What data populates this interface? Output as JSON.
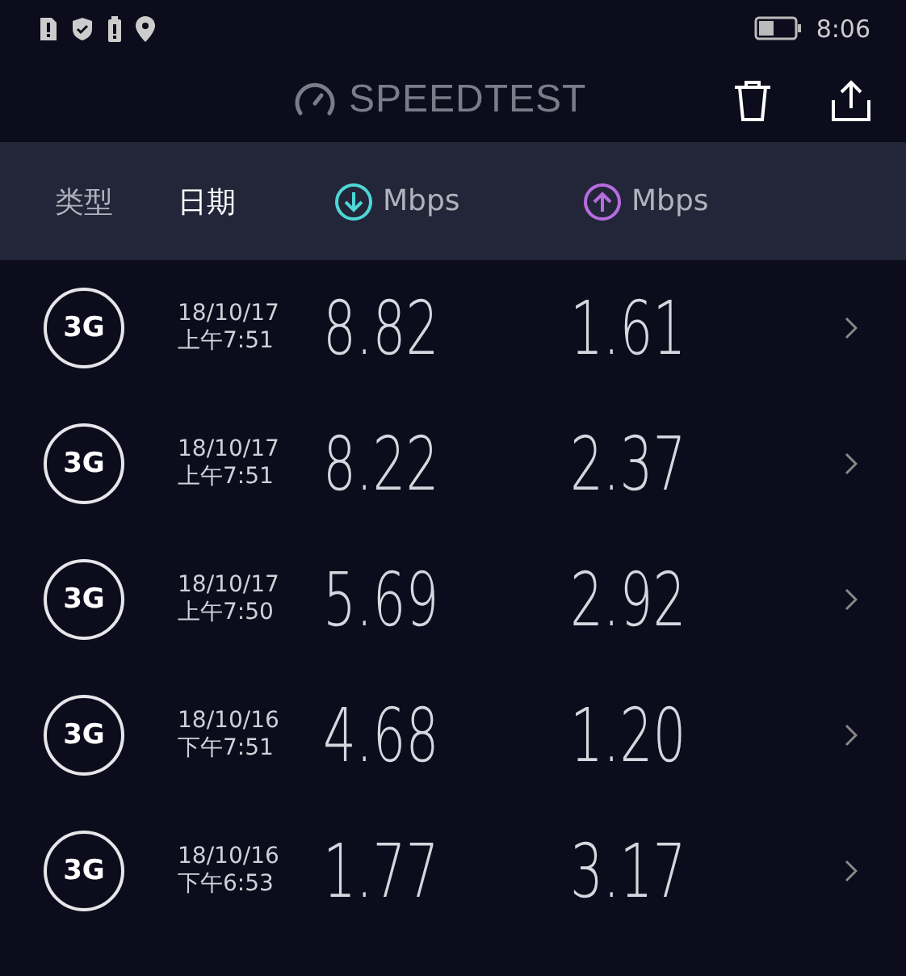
{
  "status_bar": {
    "time": "8:06"
  },
  "toolbar": {
    "title": "SPEEDTEST"
  },
  "columns": [
    {
      "label": "类型",
      "kind": "text",
      "selected": false
    },
    {
      "label": "日期",
      "kind": "text",
      "selected": true
    },
    {
      "label": "Mbps",
      "kind": "download",
      "selected": false
    },
    {
      "label": "Mbps",
      "kind": "upload",
      "selected": false
    }
  ],
  "results": [
    {
      "type": "3G",
      "date": "18/10/17",
      "time": "上午7:51",
      "download": "8.82",
      "upload": "1.61"
    },
    {
      "type": "3G",
      "date": "18/10/17",
      "time": "上午7:51",
      "download": "8.22",
      "upload": "2.37"
    },
    {
      "type": "3G",
      "date": "18/10/17",
      "time": "上午7:50",
      "download": "5.69",
      "upload": "2.92"
    },
    {
      "type": "3G",
      "date": "18/10/16",
      "time": "下午7:51",
      "download": "4.68",
      "upload": "1.20"
    },
    {
      "type": "3G",
      "date": "18/10/16",
      "time": "下午6:53",
      "download": "1.77",
      "upload": "3.17"
    }
  ]
}
